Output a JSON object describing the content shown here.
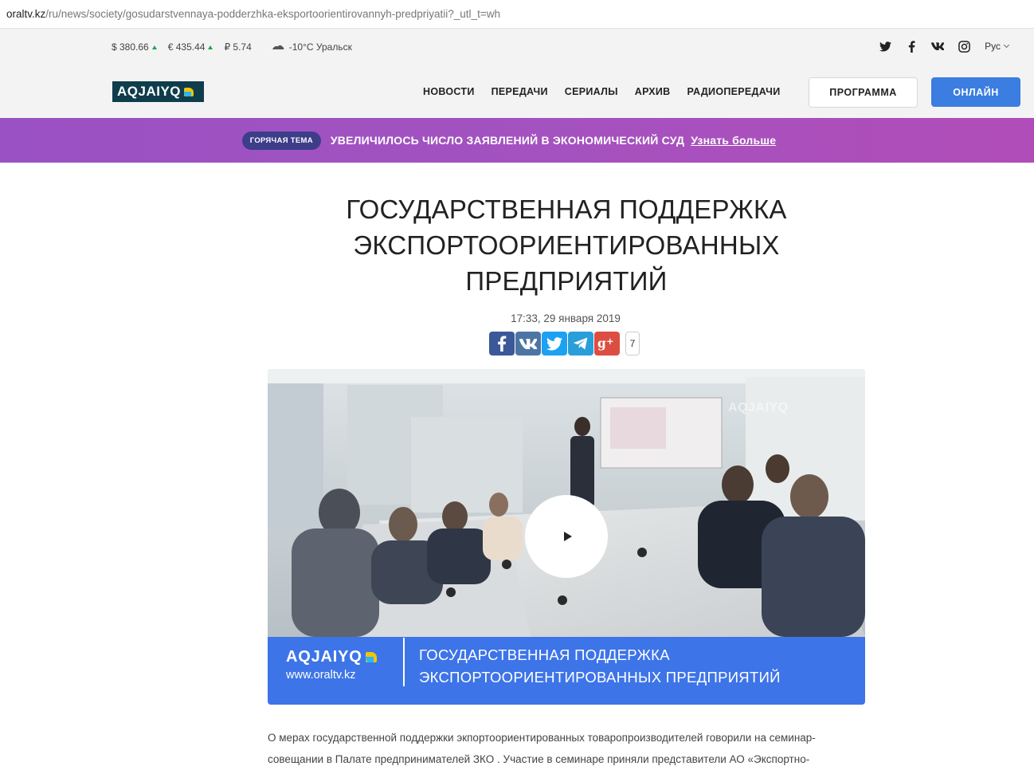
{
  "browser": {
    "url_host": "oraltv.kz",
    "url_path": "/ru/news/society/gosudarstvennaya-podderzhka-eksportoorientirovannyh-predpriyatii?_utl_t=wh"
  },
  "topinfo": {
    "usd": "$ 380.66",
    "eur": "€ 435.44",
    "rub": "₽ 5.74",
    "weather": "-10°C Уральск"
  },
  "lang": "Рус",
  "logo_text": "AQJAIYQ",
  "nav": {
    "items": [
      "НОВОСТИ",
      "ПЕРЕДАЧИ",
      "СЕРИАЛЫ",
      "АРХИВ",
      "РАДИОПЕРЕДАЧИ"
    ],
    "program": "ПРОГРАММА",
    "online": "ОНЛАЙН"
  },
  "hot": {
    "pill": "ГОРЯЧАЯ ТЕМА",
    "text": "УВЕЛИЧИЛОСЬ ЧИСЛО ЗАЯВЛЕНИЙ В ЭКОНОМИЧЕСКИЙ СУД",
    "more": "Узнать больше"
  },
  "article": {
    "title_lines": [
      "ГОСУДАРСТВЕННАЯ ПОДДЕРЖКА",
      "ЭКСПОРТООРИЕНТИРОВАННЫХ",
      "ПРЕДПРИЯТИЙ"
    ],
    "date": "17:33, 29 января 2019",
    "share_count": "7",
    "body_lines": [
      "О мерах государственной поддержки экпортоориентированных товаропроизводителей говорили на семинар-",
      "совещании в Палате предпринимателей ЗКО . Участие в семинаре приняли представители АО «Экспортно-"
    ]
  },
  "video": {
    "logo": "AQJAIYQ",
    "site": "www.oraltv.kz",
    "title_lines": [
      "ГОСУДАРСТВЕННАЯ ПОДДЕРЖКА",
      "ЭКСПОРТООРИЕНТИРОВАННЫХ ПРЕДПРИЯТИЙ"
    ],
    "watermark": "AQJAIYQ"
  },
  "colors": {
    "header_bg": "#f3f3f4",
    "logo_bg": "#0f3d4c",
    "online_btn": "#3b7de0",
    "hot_gradient_start": "#9a51c3",
    "hot_gradient_end": "#b14db8",
    "video_bar": "#3d74e8"
  },
  "icons": {
    "social": [
      "twitter-icon",
      "facebook-icon",
      "vk-icon",
      "instagram-icon"
    ],
    "share": [
      "facebook-share-icon",
      "vk-share-icon",
      "twitter-share-icon",
      "telegram-share-icon",
      "google-plus-share-icon"
    ]
  }
}
